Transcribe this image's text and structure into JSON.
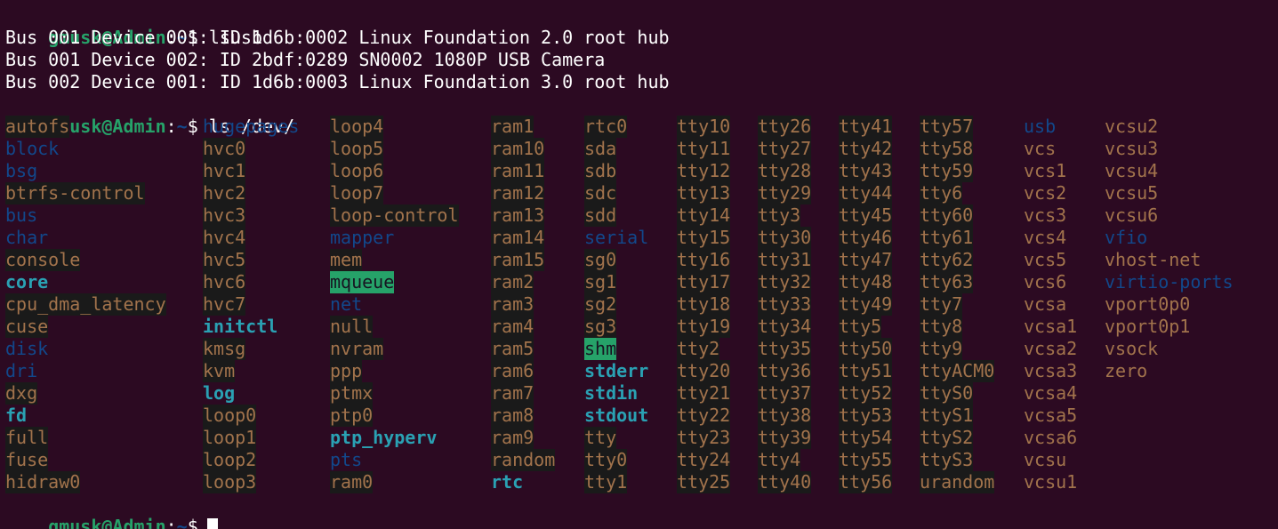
{
  "prompt": {
    "user_host": "gmusk@Admin",
    "colon": ":",
    "path": "~",
    "symbol": "$"
  },
  "commands": {
    "lsusb": "lsusb",
    "ls": "ls /dev/"
  },
  "lsusb_output": [
    "Bus 001 Device 001: ID 1d6b:0002 Linux Foundation 2.0 root hub",
    "Bus 001 Device 002: ID 2bdf:0289 SN0002 1080P USB Camera",
    "Bus 002 Device 001: ID 1d6b:0003 Linux Foundation 3.0 root hub"
  ],
  "dev_columns": [
    [
      {
        "name": "autofs",
        "type": "char"
      },
      {
        "name": "block",
        "type": "dir"
      },
      {
        "name": "bsg",
        "type": "dir"
      },
      {
        "name": "btrfs-control",
        "type": "char"
      },
      {
        "name": "bus",
        "type": "dir"
      },
      {
        "name": "char",
        "type": "dir"
      },
      {
        "name": "console",
        "type": "char"
      },
      {
        "name": "core",
        "type": "link"
      },
      {
        "name": "cpu_dma_latency",
        "type": "char"
      },
      {
        "name": "cuse",
        "type": "char"
      },
      {
        "name": "disk",
        "type": "dir"
      },
      {
        "name": "dri",
        "type": "dir"
      },
      {
        "name": "dxg",
        "type": "char"
      },
      {
        "name": "fd",
        "type": "link"
      },
      {
        "name": "full",
        "type": "char"
      },
      {
        "name": "fuse",
        "type": "char"
      },
      {
        "name": "hidraw0",
        "type": "char"
      }
    ],
    [
      {
        "name": "hugepages",
        "type": "dir"
      },
      {
        "name": "hvc0",
        "type": "char"
      },
      {
        "name": "hvc1",
        "type": "char"
      },
      {
        "name": "hvc2",
        "type": "char"
      },
      {
        "name": "hvc3",
        "type": "char"
      },
      {
        "name": "hvc4",
        "type": "char"
      },
      {
        "name": "hvc5",
        "type": "char"
      },
      {
        "name": "hvc6",
        "type": "char"
      },
      {
        "name": "hvc7",
        "type": "char"
      },
      {
        "name": "initctl",
        "type": "link"
      },
      {
        "name": "kmsg",
        "type": "char"
      },
      {
        "name": "kvm",
        "type": "char"
      },
      {
        "name": "log",
        "type": "link"
      },
      {
        "name": "loop0",
        "type": "char"
      },
      {
        "name": "loop1",
        "type": "char"
      },
      {
        "name": "loop2",
        "type": "char"
      },
      {
        "name": "loop3",
        "type": "char"
      }
    ],
    [
      {
        "name": "loop4",
        "type": "char"
      },
      {
        "name": "loop5",
        "type": "char"
      },
      {
        "name": "loop6",
        "type": "char"
      },
      {
        "name": "loop7",
        "type": "char"
      },
      {
        "name": "loop-control",
        "type": "char"
      },
      {
        "name": "mapper",
        "type": "dir"
      },
      {
        "name": "mem",
        "type": "char"
      },
      {
        "name": "mqueue",
        "type": "sticky"
      },
      {
        "name": "net",
        "type": "dir"
      },
      {
        "name": "null",
        "type": "char"
      },
      {
        "name": "nvram",
        "type": "char"
      },
      {
        "name": "ppp",
        "type": "char"
      },
      {
        "name": "ptmx",
        "type": "char"
      },
      {
        "name": "ptp0",
        "type": "char"
      },
      {
        "name": "ptp_hyperv",
        "type": "link"
      },
      {
        "name": "pts",
        "type": "dir"
      },
      {
        "name": "ram0",
        "type": "char"
      }
    ],
    [
      {
        "name": "ram1",
        "type": "char"
      },
      {
        "name": "ram10",
        "type": "char"
      },
      {
        "name": "ram11",
        "type": "char"
      },
      {
        "name": "ram12",
        "type": "char"
      },
      {
        "name": "ram13",
        "type": "char"
      },
      {
        "name": "ram14",
        "type": "char"
      },
      {
        "name": "ram15",
        "type": "char"
      },
      {
        "name": "ram2",
        "type": "char"
      },
      {
        "name": "ram3",
        "type": "char"
      },
      {
        "name": "ram4",
        "type": "char"
      },
      {
        "name": "ram5",
        "type": "char"
      },
      {
        "name": "ram6",
        "type": "char"
      },
      {
        "name": "ram7",
        "type": "char"
      },
      {
        "name": "ram8",
        "type": "char"
      },
      {
        "name": "ram9",
        "type": "char"
      },
      {
        "name": "random",
        "type": "char"
      },
      {
        "name": "rtc",
        "type": "link"
      }
    ],
    [
      {
        "name": "rtc0",
        "type": "char"
      },
      {
        "name": "sda",
        "type": "char"
      },
      {
        "name": "sdb",
        "type": "char"
      },
      {
        "name": "sdc",
        "type": "char"
      },
      {
        "name": "sdd",
        "type": "char"
      },
      {
        "name": "serial",
        "type": "dir"
      },
      {
        "name": "sg0",
        "type": "char"
      },
      {
        "name": "sg1",
        "type": "char"
      },
      {
        "name": "sg2",
        "type": "char"
      },
      {
        "name": "sg3",
        "type": "char"
      },
      {
        "name": "shm",
        "type": "sticky"
      },
      {
        "name": "stderr",
        "type": "link"
      },
      {
        "name": "stdin",
        "type": "link"
      },
      {
        "name": "stdout",
        "type": "link"
      },
      {
        "name": "tty",
        "type": "char"
      },
      {
        "name": "tty0",
        "type": "char"
      },
      {
        "name": "tty1",
        "type": "char"
      }
    ],
    [
      {
        "name": "tty10",
        "type": "char"
      },
      {
        "name": "tty11",
        "type": "char"
      },
      {
        "name": "tty12",
        "type": "char"
      },
      {
        "name": "tty13",
        "type": "char"
      },
      {
        "name": "tty14",
        "type": "char"
      },
      {
        "name": "tty15",
        "type": "char"
      },
      {
        "name": "tty16",
        "type": "char"
      },
      {
        "name": "tty17",
        "type": "char"
      },
      {
        "name": "tty18",
        "type": "char"
      },
      {
        "name": "tty19",
        "type": "char"
      },
      {
        "name": "tty2",
        "type": "char"
      },
      {
        "name": "tty20",
        "type": "char"
      },
      {
        "name": "tty21",
        "type": "char"
      },
      {
        "name": "tty22",
        "type": "char"
      },
      {
        "name": "tty23",
        "type": "char"
      },
      {
        "name": "tty24",
        "type": "char"
      },
      {
        "name": "tty25",
        "type": "char"
      }
    ],
    [
      {
        "name": "tty26",
        "type": "char"
      },
      {
        "name": "tty27",
        "type": "char"
      },
      {
        "name": "tty28",
        "type": "char"
      },
      {
        "name": "tty29",
        "type": "char"
      },
      {
        "name": "tty3",
        "type": "char"
      },
      {
        "name": "tty30",
        "type": "char"
      },
      {
        "name": "tty31",
        "type": "char"
      },
      {
        "name": "tty32",
        "type": "char"
      },
      {
        "name": "tty33",
        "type": "char"
      },
      {
        "name": "tty34",
        "type": "char"
      },
      {
        "name": "tty35",
        "type": "char"
      },
      {
        "name": "tty36",
        "type": "char"
      },
      {
        "name": "tty37",
        "type": "char"
      },
      {
        "name": "tty38",
        "type": "char"
      },
      {
        "name": "tty39",
        "type": "char"
      },
      {
        "name": "tty4",
        "type": "char"
      },
      {
        "name": "tty40",
        "type": "char"
      }
    ],
    [
      {
        "name": "tty41",
        "type": "char"
      },
      {
        "name": "tty42",
        "type": "char"
      },
      {
        "name": "tty43",
        "type": "char"
      },
      {
        "name": "tty44",
        "type": "char"
      },
      {
        "name": "tty45",
        "type": "char"
      },
      {
        "name": "tty46",
        "type": "char"
      },
      {
        "name": "tty47",
        "type": "char"
      },
      {
        "name": "tty48",
        "type": "char"
      },
      {
        "name": "tty49",
        "type": "char"
      },
      {
        "name": "tty5",
        "type": "char"
      },
      {
        "name": "tty50",
        "type": "char"
      },
      {
        "name": "tty51",
        "type": "char"
      },
      {
        "name": "tty52",
        "type": "char"
      },
      {
        "name": "tty53",
        "type": "char"
      },
      {
        "name": "tty54",
        "type": "char"
      },
      {
        "name": "tty55",
        "type": "char"
      },
      {
        "name": "tty56",
        "type": "char"
      }
    ],
    [
      {
        "name": "tty57",
        "type": "char"
      },
      {
        "name": "tty58",
        "type": "char"
      },
      {
        "name": "tty59",
        "type": "char"
      },
      {
        "name": "tty6",
        "type": "char"
      },
      {
        "name": "tty60",
        "type": "char"
      },
      {
        "name": "tty61",
        "type": "char"
      },
      {
        "name": "tty62",
        "type": "char"
      },
      {
        "name": "tty63",
        "type": "char"
      },
      {
        "name": "tty7",
        "type": "char"
      },
      {
        "name": "tty8",
        "type": "char"
      },
      {
        "name": "tty9",
        "type": "char"
      },
      {
        "name": "ttyACM0",
        "type": "char"
      },
      {
        "name": "ttyS0",
        "type": "char"
      },
      {
        "name": "ttyS1",
        "type": "char"
      },
      {
        "name": "ttyS2",
        "type": "char"
      },
      {
        "name": "ttyS3",
        "type": "char"
      },
      {
        "name": "urandom",
        "type": "char"
      }
    ],
    [
      {
        "name": "usb",
        "type": "dir"
      },
      {
        "name": "vcs",
        "type": "plain"
      },
      {
        "name": "vcs1",
        "type": "plain"
      },
      {
        "name": "vcs2",
        "type": "plain"
      },
      {
        "name": "vcs3",
        "type": "plain"
      },
      {
        "name": "vcs4",
        "type": "plain"
      },
      {
        "name": "vcs5",
        "type": "plain"
      },
      {
        "name": "vcs6",
        "type": "plain"
      },
      {
        "name": "vcsa",
        "type": "plain"
      },
      {
        "name": "vcsa1",
        "type": "plain"
      },
      {
        "name": "vcsa2",
        "type": "plain"
      },
      {
        "name": "vcsa3",
        "type": "plain"
      },
      {
        "name": "vcsa4",
        "type": "plain"
      },
      {
        "name": "vcsa5",
        "type": "plain"
      },
      {
        "name": "vcsa6",
        "type": "plain"
      },
      {
        "name": "vcsu",
        "type": "plain"
      },
      {
        "name": "vcsu1",
        "type": "plain"
      }
    ],
    [
      {
        "name": "vcsu2",
        "type": "plain"
      },
      {
        "name": "vcsu3",
        "type": "plain"
      },
      {
        "name": "vcsu4",
        "type": "plain"
      },
      {
        "name": "vcsu5",
        "type": "plain"
      },
      {
        "name": "vcsu6",
        "type": "plain"
      },
      {
        "name": "vfio",
        "type": "dir"
      },
      {
        "name": "vhost-net",
        "type": "plain"
      },
      {
        "name": "virtio-ports",
        "type": "dir"
      },
      {
        "name": "vport0p0",
        "type": "plain"
      },
      {
        "name": "vport0p1",
        "type": "plain"
      },
      {
        "name": "vsock",
        "type": "plain"
      },
      {
        "name": "zero",
        "type": "plain"
      }
    ]
  ],
  "colors": {
    "background": "#2c0a22",
    "prompt_user": "#26a269",
    "prompt_path": "#12488b",
    "device": "#a2734c",
    "directory": "#12488b",
    "symlink": "#2aa1b3",
    "sticky_bg": "#26a269"
  }
}
